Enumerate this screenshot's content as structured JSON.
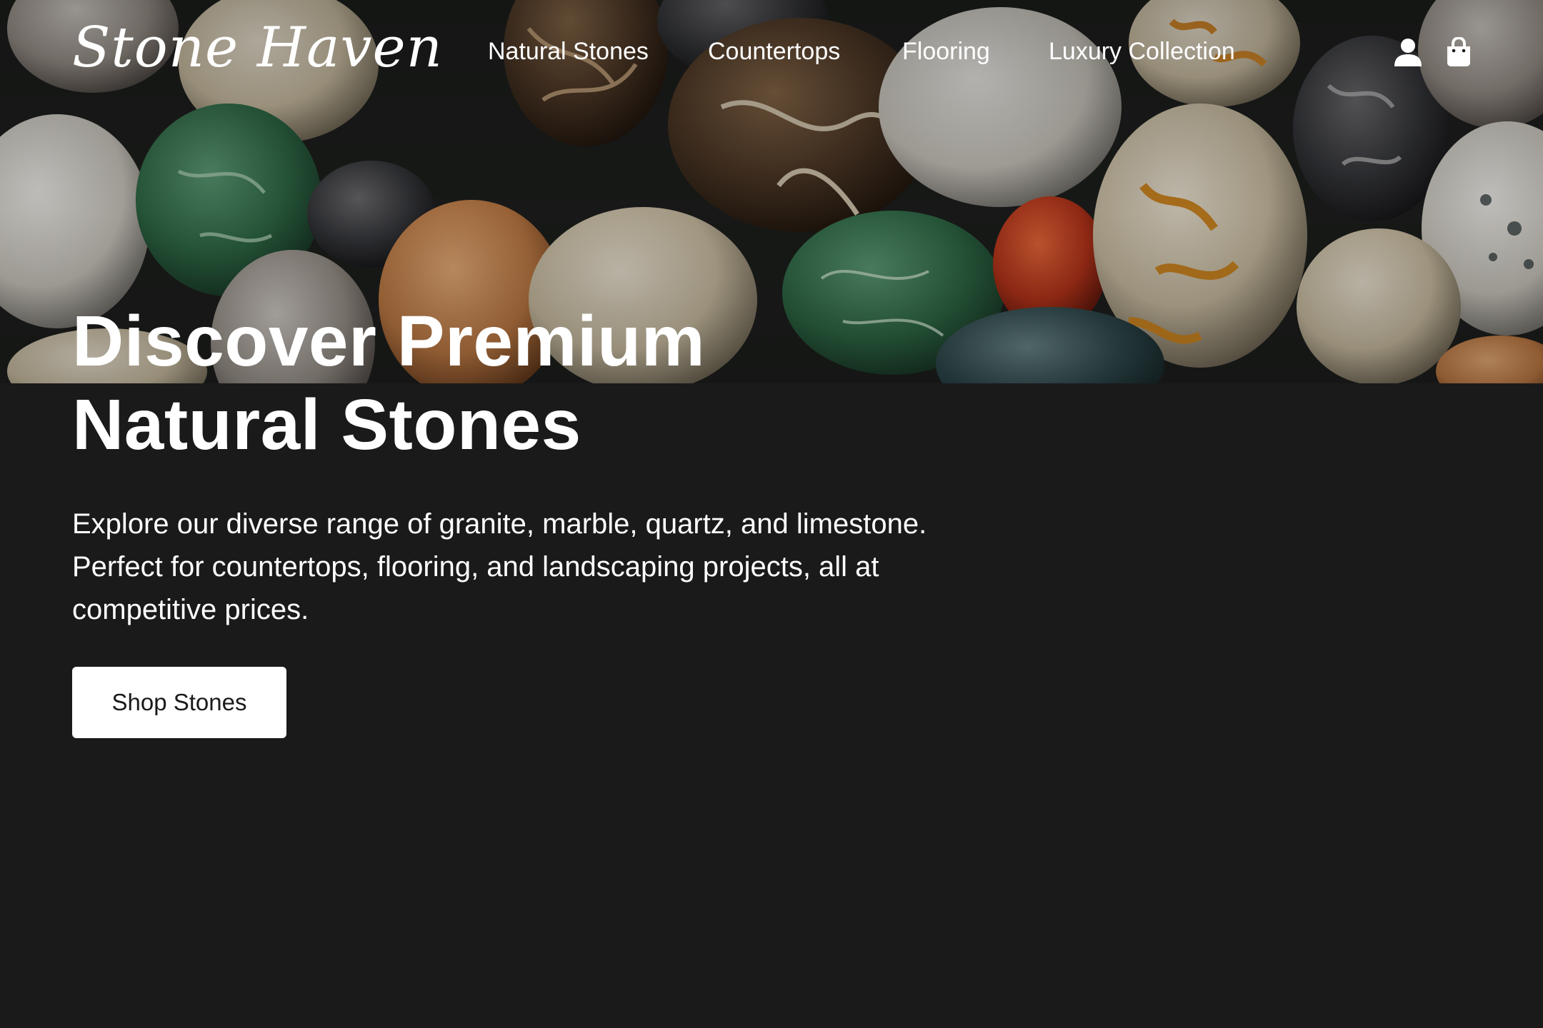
{
  "header": {
    "logo": "Stone Haven",
    "nav": [
      {
        "label": "Natural Stones"
      },
      {
        "label": "Countertops"
      },
      {
        "label": "Flooring"
      },
      {
        "label": "Luxury Collection"
      }
    ],
    "icons": [
      "user-icon",
      "shopping-bag-icon"
    ]
  },
  "hero": {
    "title_line1": "Discover Premium",
    "title_line2": "Natural Stones",
    "description": "Explore our diverse range of granite, marble, quartz, and limestone. Perfect for countertops, flooring, and landscaping projects, all at competitive prices.",
    "cta_label": "Shop Stones",
    "image": "polished-pebble-stones-photo"
  },
  "colors": {
    "background": "#1a1a1a",
    "text": "#ffffff",
    "button_bg": "#ffffff",
    "button_text": "#1a1a1a"
  }
}
